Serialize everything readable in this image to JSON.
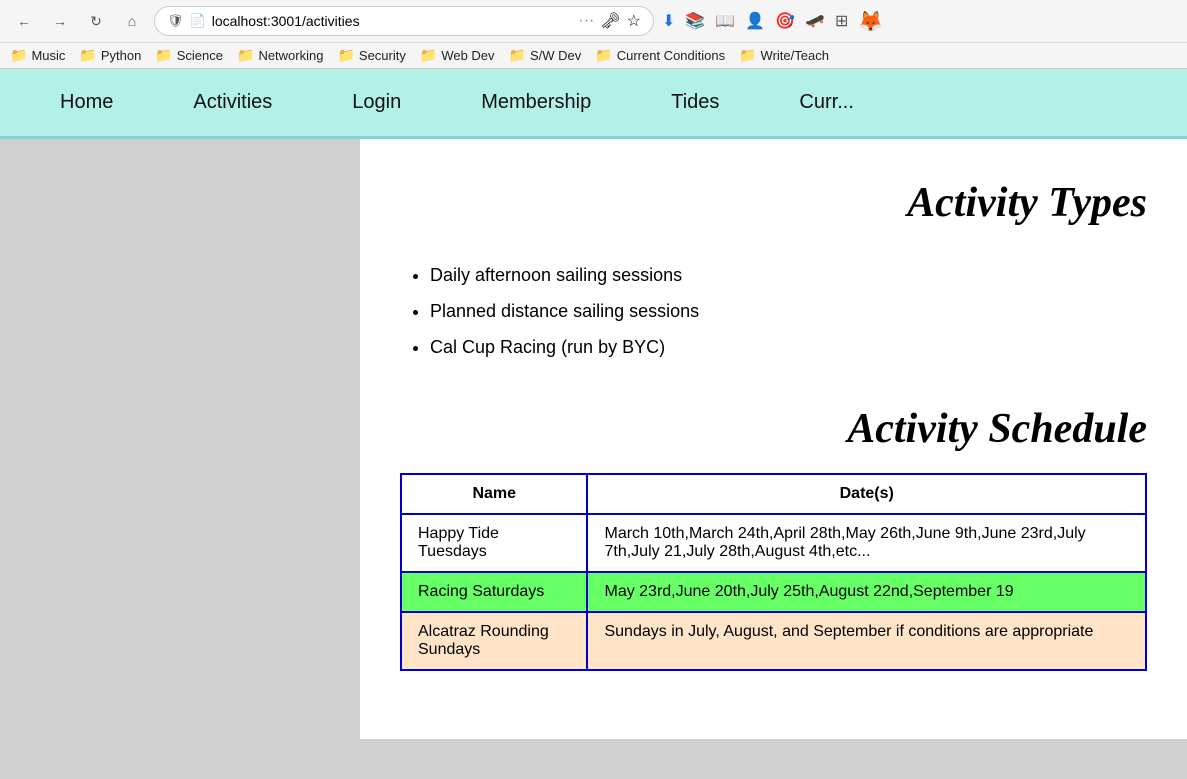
{
  "browser": {
    "url": "localhost:3001/activities",
    "back_label": "←",
    "forward_label": "→",
    "refresh_label": "↻",
    "home_label": "⌂"
  },
  "bookmarks": [
    {
      "label": "Music",
      "icon": "📁"
    },
    {
      "label": "Python",
      "icon": "📁"
    },
    {
      "label": "Science",
      "icon": "📁"
    },
    {
      "label": "Networking",
      "icon": "📁"
    },
    {
      "label": "Security",
      "icon": "📁"
    },
    {
      "label": "Web Dev",
      "icon": "📁"
    },
    {
      "label": "S/W Dev",
      "icon": "📁"
    },
    {
      "label": "Current Conditions",
      "icon": "📁"
    },
    {
      "label": "Write/Teach",
      "icon": "📁"
    }
  ],
  "navbar": {
    "items": [
      {
        "label": "Home",
        "href": "#"
      },
      {
        "label": "Activities",
        "href": "#"
      },
      {
        "label": "Login",
        "href": "#"
      },
      {
        "label": "Membership",
        "href": "#"
      },
      {
        "label": "Tides",
        "href": "#"
      },
      {
        "label": "Curr...",
        "href": "#"
      }
    ]
  },
  "page": {
    "title": "Activity Types",
    "activity_types": [
      "Daily afternoon sailing sessions",
      "Planned distance sailing sessions",
      "Cal Cup Racing (run by BYC)"
    ],
    "schedule_title": "Activity Schedule",
    "table": {
      "headers": [
        "Name",
        "Date(s)"
      ],
      "rows": [
        {
          "name": "Happy Tide Tuesdays",
          "dates": "March 10th,March 24th,April 28th,May 26th,June 9th,June 23rd,July 7th,July 21,July 28th,August 4th,etc...",
          "rowClass": "row-happy"
        },
        {
          "name": "Racing Saturdays",
          "dates": "May 23rd,June 20th,July 25th,August 22nd,September 19",
          "rowClass": "row-racing"
        },
        {
          "name": "Alcatraz Rounding Sundays",
          "dates": "Sundays in July, August, and September if conditions are appropriate",
          "rowClass": "row-alcatraz"
        }
      ]
    }
  }
}
